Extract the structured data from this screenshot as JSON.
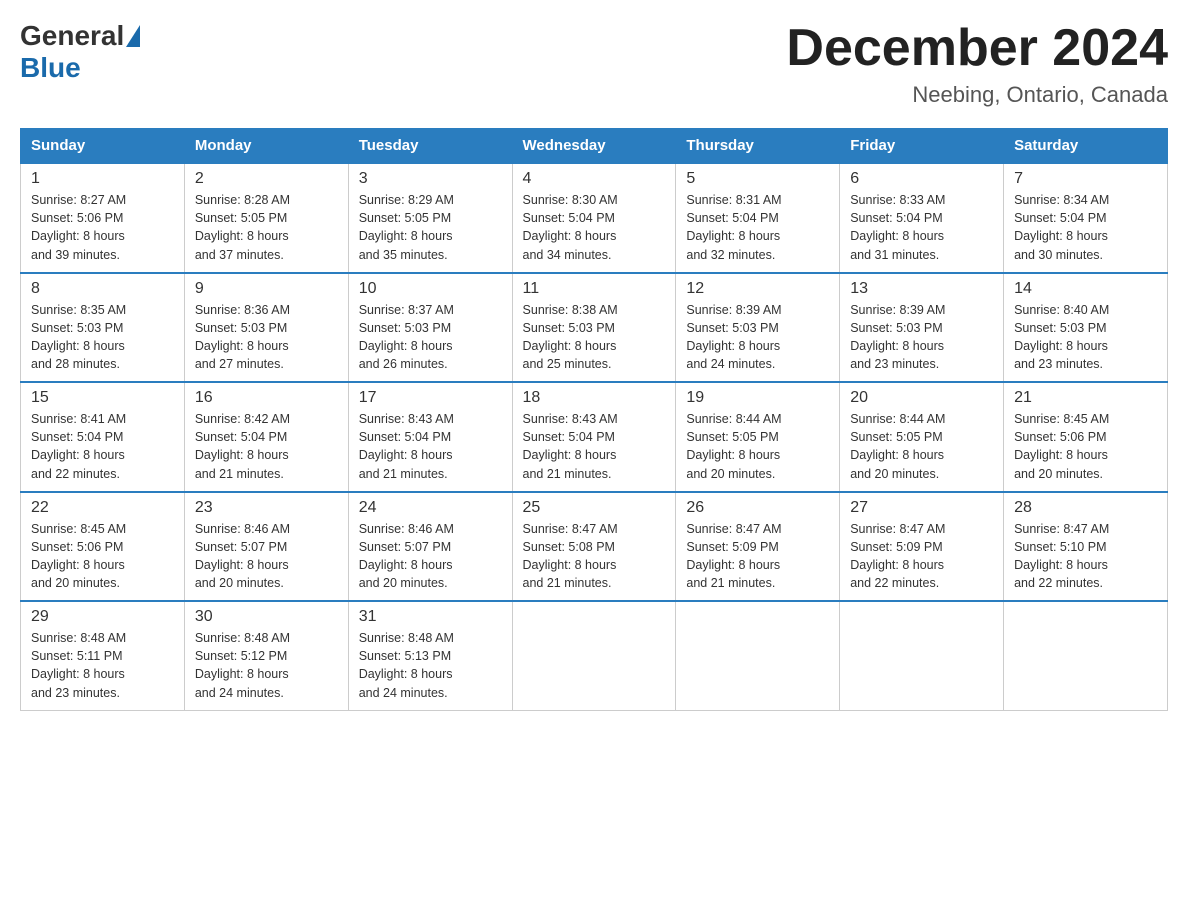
{
  "header": {
    "logo_general": "General",
    "logo_blue": "Blue",
    "month_title": "December 2024",
    "location": "Neebing, Ontario, Canada"
  },
  "days_of_week": [
    "Sunday",
    "Monday",
    "Tuesday",
    "Wednesday",
    "Thursday",
    "Friday",
    "Saturday"
  ],
  "weeks": [
    [
      {
        "day": "1",
        "sunrise": "8:27 AM",
        "sunset": "5:06 PM",
        "daylight": "8 hours and 39 minutes."
      },
      {
        "day": "2",
        "sunrise": "8:28 AM",
        "sunset": "5:05 PM",
        "daylight": "8 hours and 37 minutes."
      },
      {
        "day": "3",
        "sunrise": "8:29 AM",
        "sunset": "5:05 PM",
        "daylight": "8 hours and 35 minutes."
      },
      {
        "day": "4",
        "sunrise": "8:30 AM",
        "sunset": "5:04 PM",
        "daylight": "8 hours and 34 minutes."
      },
      {
        "day": "5",
        "sunrise": "8:31 AM",
        "sunset": "5:04 PM",
        "daylight": "8 hours and 32 minutes."
      },
      {
        "day": "6",
        "sunrise": "8:33 AM",
        "sunset": "5:04 PM",
        "daylight": "8 hours and 31 minutes."
      },
      {
        "day": "7",
        "sunrise": "8:34 AM",
        "sunset": "5:04 PM",
        "daylight": "8 hours and 30 minutes."
      }
    ],
    [
      {
        "day": "8",
        "sunrise": "8:35 AM",
        "sunset": "5:03 PM",
        "daylight": "8 hours and 28 minutes."
      },
      {
        "day": "9",
        "sunrise": "8:36 AM",
        "sunset": "5:03 PM",
        "daylight": "8 hours and 27 minutes."
      },
      {
        "day": "10",
        "sunrise": "8:37 AM",
        "sunset": "5:03 PM",
        "daylight": "8 hours and 26 minutes."
      },
      {
        "day": "11",
        "sunrise": "8:38 AM",
        "sunset": "5:03 PM",
        "daylight": "8 hours and 25 minutes."
      },
      {
        "day": "12",
        "sunrise": "8:39 AM",
        "sunset": "5:03 PM",
        "daylight": "8 hours and 24 minutes."
      },
      {
        "day": "13",
        "sunrise": "8:39 AM",
        "sunset": "5:03 PM",
        "daylight": "8 hours and 23 minutes."
      },
      {
        "day": "14",
        "sunrise": "8:40 AM",
        "sunset": "5:03 PM",
        "daylight": "8 hours and 23 minutes."
      }
    ],
    [
      {
        "day": "15",
        "sunrise": "8:41 AM",
        "sunset": "5:04 PM",
        "daylight": "8 hours and 22 minutes."
      },
      {
        "day": "16",
        "sunrise": "8:42 AM",
        "sunset": "5:04 PM",
        "daylight": "8 hours and 21 minutes."
      },
      {
        "day": "17",
        "sunrise": "8:43 AM",
        "sunset": "5:04 PM",
        "daylight": "8 hours and 21 minutes."
      },
      {
        "day": "18",
        "sunrise": "8:43 AM",
        "sunset": "5:04 PM",
        "daylight": "8 hours and 21 minutes."
      },
      {
        "day": "19",
        "sunrise": "8:44 AM",
        "sunset": "5:05 PM",
        "daylight": "8 hours and 20 minutes."
      },
      {
        "day": "20",
        "sunrise": "8:44 AM",
        "sunset": "5:05 PM",
        "daylight": "8 hours and 20 minutes."
      },
      {
        "day": "21",
        "sunrise": "8:45 AM",
        "sunset": "5:06 PM",
        "daylight": "8 hours and 20 minutes."
      }
    ],
    [
      {
        "day": "22",
        "sunrise": "8:45 AM",
        "sunset": "5:06 PM",
        "daylight": "8 hours and 20 minutes."
      },
      {
        "day": "23",
        "sunrise": "8:46 AM",
        "sunset": "5:07 PM",
        "daylight": "8 hours and 20 minutes."
      },
      {
        "day": "24",
        "sunrise": "8:46 AM",
        "sunset": "5:07 PM",
        "daylight": "8 hours and 20 minutes."
      },
      {
        "day": "25",
        "sunrise": "8:47 AM",
        "sunset": "5:08 PM",
        "daylight": "8 hours and 21 minutes."
      },
      {
        "day": "26",
        "sunrise": "8:47 AM",
        "sunset": "5:09 PM",
        "daylight": "8 hours and 21 minutes."
      },
      {
        "day": "27",
        "sunrise": "8:47 AM",
        "sunset": "5:09 PM",
        "daylight": "8 hours and 22 minutes."
      },
      {
        "day": "28",
        "sunrise": "8:47 AM",
        "sunset": "5:10 PM",
        "daylight": "8 hours and 22 minutes."
      }
    ],
    [
      {
        "day": "29",
        "sunrise": "8:48 AM",
        "sunset": "5:11 PM",
        "daylight": "8 hours and 23 minutes."
      },
      {
        "day": "30",
        "sunrise": "8:48 AM",
        "sunset": "5:12 PM",
        "daylight": "8 hours and 24 minutes."
      },
      {
        "day": "31",
        "sunrise": "8:48 AM",
        "sunset": "5:13 PM",
        "daylight": "8 hours and 24 minutes."
      },
      null,
      null,
      null,
      null
    ]
  ],
  "labels": {
    "sunrise": "Sunrise:",
    "sunset": "Sunset:",
    "daylight": "Daylight:"
  }
}
